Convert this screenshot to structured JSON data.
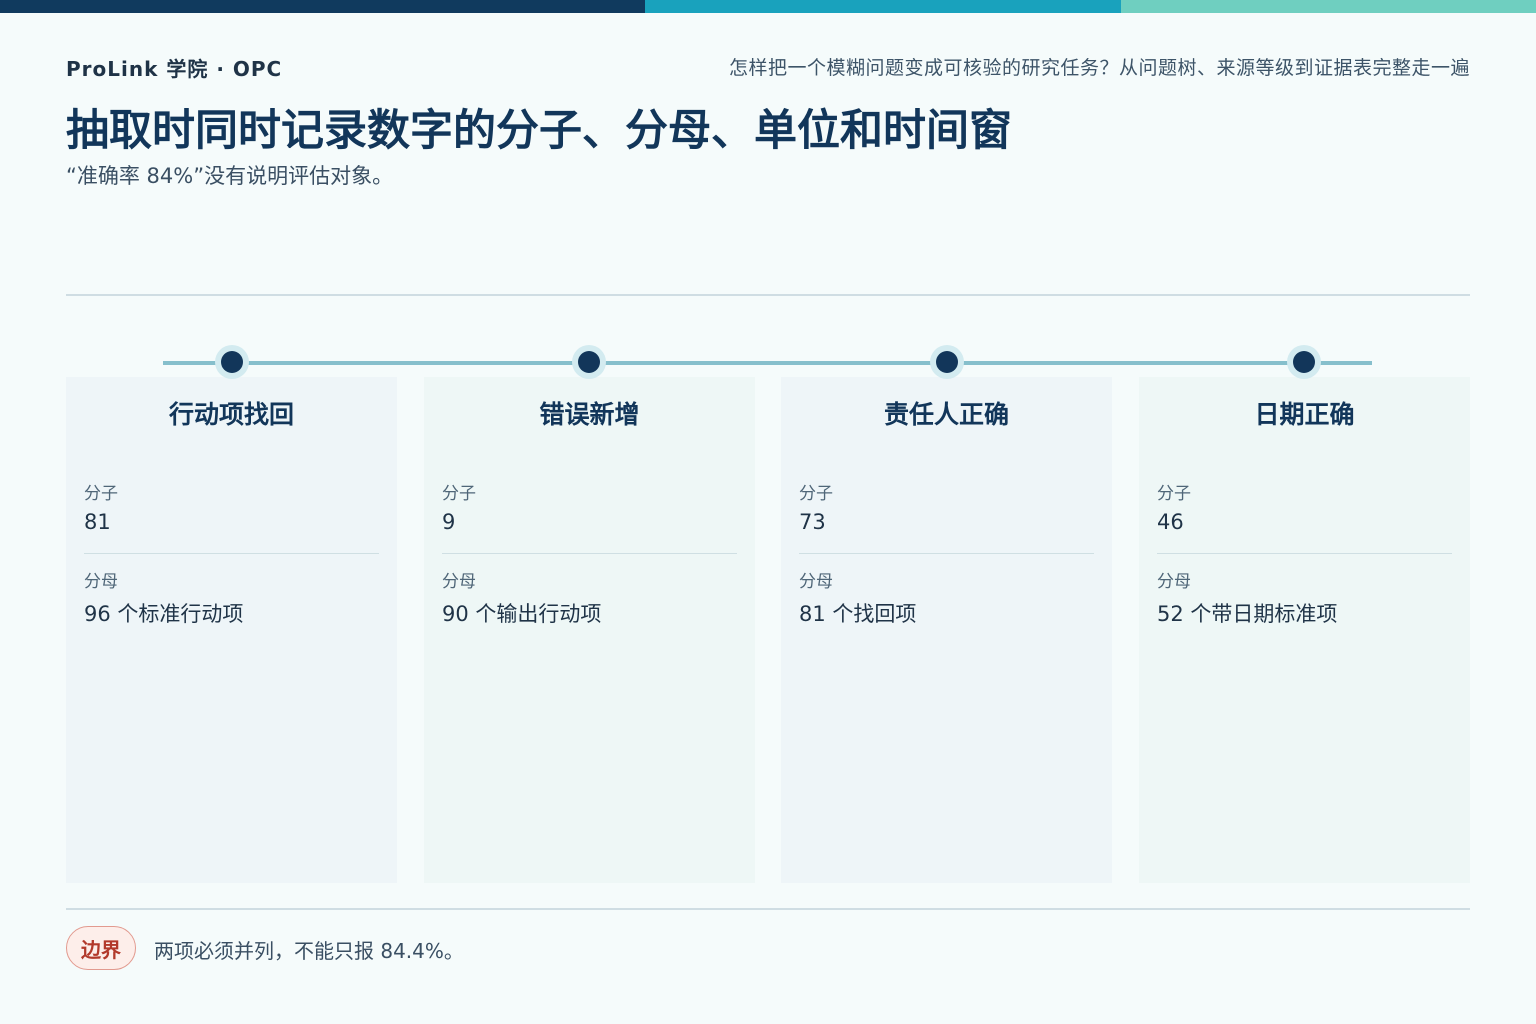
{
  "colors": {
    "bar_dark": "#103a5e",
    "bar_teal": "#19a2bd",
    "bar_mint": "#6fcfc0",
    "title": "#12365a",
    "badge_text": "#b2392b"
  },
  "header": {
    "brand": "ProLink 学院 · OPC",
    "subject": "怎样把一个模糊问题变成可核验的研究任务？从问题树、来源等级到证据表完整走一遍",
    "title": "抽取时同时记录数字的分子、分母、单位和时间窗",
    "subtitle": "“准确率 84%”没有说明评估对象。"
  },
  "cards": [
    {
      "title": "行动项找回",
      "numerator_label": "分子",
      "numerator": "81",
      "denominator_label": "分母",
      "denominator": "96 个标准行动项"
    },
    {
      "title": "错误新增",
      "numerator_label": "分子",
      "numerator": "9",
      "denominator_label": "分母",
      "denominator": "90 个输出行动项"
    },
    {
      "title": "责任人正确",
      "numerator_label": "分子",
      "numerator": "73",
      "denominator_label": "分母",
      "denominator": "81 个找回项"
    },
    {
      "title": "日期正确",
      "numerator_label": "分子",
      "numerator": "46",
      "denominator_label": "分母",
      "denominator": "52 个带日期标准项"
    }
  ],
  "footer": {
    "badge": "边界",
    "note": "两项必须并列，不能只报 84.4%。"
  }
}
